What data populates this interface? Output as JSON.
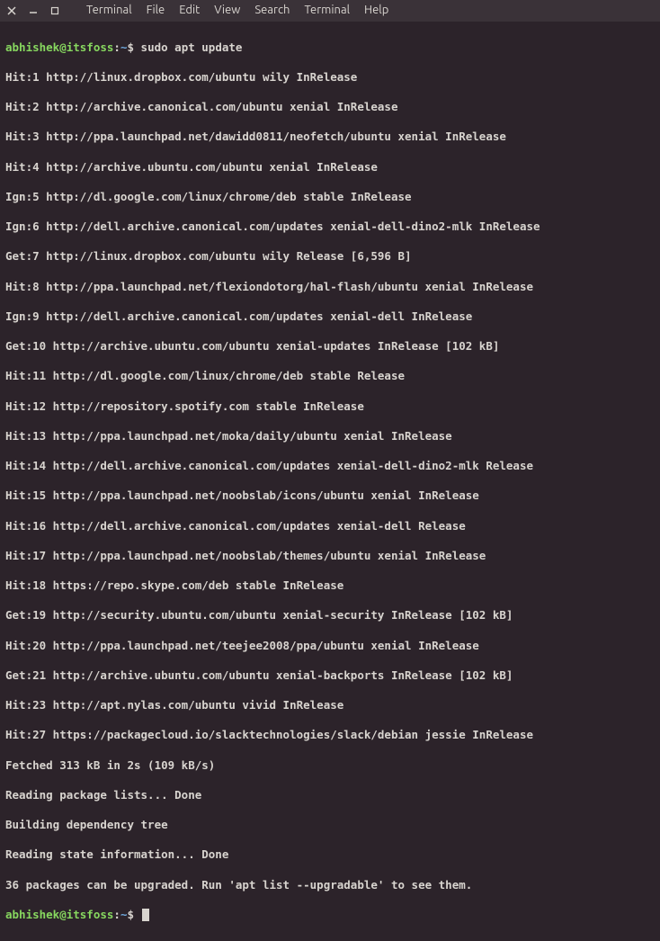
{
  "window": {
    "close_icon": "✕",
    "min_icon": "–",
    "max_icon": "▢"
  },
  "menu": {
    "terminal": "Terminal",
    "file": "File",
    "edit": "Edit",
    "view": "View",
    "search": "Search",
    "terminal2": "Terminal",
    "help": "Help"
  },
  "prompt1": {
    "user": "abhishek@itsfoss",
    "colon": ":",
    "path": "~",
    "dollar": "$ ",
    "command": "sudo apt update"
  },
  "lines": {
    "l1": "Hit:1 http://linux.dropbox.com/ubuntu wily InRelease",
    "l2": "Hit:2 http://archive.canonical.com/ubuntu xenial InRelease",
    "l3": "Hit:3 http://ppa.launchpad.net/dawidd0811/neofetch/ubuntu xenial InRelease",
    "l4": "Hit:4 http://archive.ubuntu.com/ubuntu xenial InRelease",
    "l5": "Ign:5 http://dl.google.com/linux/chrome/deb stable InRelease",
    "l6": "Ign:6 http://dell.archive.canonical.com/updates xenial-dell-dino2-mlk InRelease",
    "l7": "Get:7 http://linux.dropbox.com/ubuntu wily Release [6,596 B]",
    "l8": "Hit:8 http://ppa.launchpad.net/flexiondotorg/hal-flash/ubuntu xenial InRelease",
    "l9": "Ign:9 http://dell.archive.canonical.com/updates xenial-dell InRelease",
    "l10": "Get:10 http://archive.ubuntu.com/ubuntu xenial-updates InRelease [102 kB]",
    "l11": "Hit:11 http://dl.google.com/linux/chrome/deb stable Release",
    "l12": "Hit:12 http://repository.spotify.com stable InRelease",
    "l13": "Hit:13 http://ppa.launchpad.net/moka/daily/ubuntu xenial InRelease",
    "l14": "Hit:14 http://dell.archive.canonical.com/updates xenial-dell-dino2-mlk Release",
    "l15": "Hit:15 http://ppa.launchpad.net/noobslab/icons/ubuntu xenial InRelease",
    "l16": "Hit:16 http://dell.archive.canonical.com/updates xenial-dell Release",
    "l17": "Hit:17 http://ppa.launchpad.net/noobslab/themes/ubuntu xenial InRelease",
    "l18": "Hit:18 https://repo.skype.com/deb stable InRelease",
    "l19": "Get:19 http://security.ubuntu.com/ubuntu xenial-security InRelease [102 kB]",
    "l20": "Hit:20 http://ppa.launchpad.net/teejee2008/ppa/ubuntu xenial InRelease",
    "l21": "Get:21 http://archive.ubuntu.com/ubuntu xenial-backports InRelease [102 kB]",
    "l22": "Hit:23 http://apt.nylas.com/ubuntu vivid InRelease",
    "l23": "Hit:27 https://packagecloud.io/slacktechnologies/slack/debian jessie InRelease",
    "l24": "Fetched 313 kB in 2s (109 kB/s)",
    "l25": "Reading package lists... Done",
    "l26": "Building dependency tree",
    "l27": "Reading state information... Done",
    "l28": "36 packages can be upgraded. Run 'apt list --upgradable' to see them."
  },
  "prompt2": {
    "user": "abhishek@itsfoss",
    "colon": ":",
    "path": "~",
    "dollar": "$ "
  }
}
